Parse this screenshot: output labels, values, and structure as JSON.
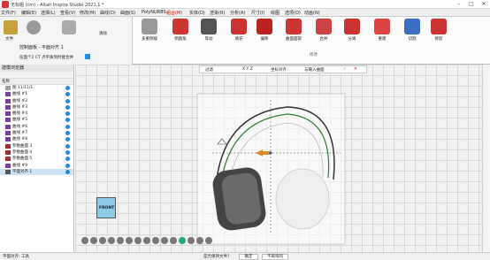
{
  "titlebar": {
    "title": "无标题 (cm) - Altair Inspire Studio 2021.1 *"
  },
  "menubar": {
    "items": [
      "文件(F)",
      "编辑(E)",
      "选择(L)",
      "查看(V)",
      "修改(M)",
      "曲线(D)",
      "曲面(S)",
      "PolyNURBS",
      "组合(M)",
      "实体(D)",
      "渲染(R)",
      "分析(A)",
      "尺寸(I)",
      "绘图",
      "选项(O)",
      "动画(N)"
    ],
    "active_index": 8
  },
  "ribbon": {
    "left": {
      "file_label": "文件",
      "panel_label": "控制面板 - 平面对齐 1",
      "option_label": "任面个2 CT 点平质到时能合并",
      "mode_label": "清除"
    },
    "buttons": [
      "多重倒棱",
      "倒圆角",
      "等动",
      "填充",
      "偏移",
      "曲面面取",
      "合并",
      "分离",
      "重建",
      "切割",
      "修剪"
    ],
    "group_label": "修改"
  },
  "left_panel": {
    "title": "建模浏览器",
    "header": "名称",
    "items": [
      {
        "label": "图 11/11/1",
        "icon": "folder-icon"
      },
      {
        "label": "曲线 #1",
        "icon": "curve-icon"
      },
      {
        "label": "曲线 #2",
        "icon": "curve-icon"
      },
      {
        "label": "曲线 #3",
        "icon": "curve-icon"
      },
      {
        "label": "曲线 #4",
        "icon": "curve-icon"
      },
      {
        "label": "曲线 #5",
        "icon": "curve-icon"
      },
      {
        "label": "曲线 #6",
        "icon": "curve-icon"
      },
      {
        "label": "曲线 #7",
        "icon": "curve-icon"
      },
      {
        "label": "曲线 #8",
        "icon": "curve-icon"
      },
      {
        "label": "参数曲面 3",
        "icon": "surface-icon"
      },
      {
        "label": "参数曲面 4",
        "icon": "surface-icon"
      },
      {
        "label": "参数曲面 5",
        "icon": "surface-icon"
      },
      {
        "label": "曲线 #9",
        "icon": "curve-icon"
      },
      {
        "label": "平面对齐 1",
        "icon": "plane-icon",
        "selected": true
      }
    ]
  },
  "viewport_toolbar": {
    "item1": "过滤",
    "item2": "X Y Z",
    "item3": "坐标对齐",
    "item4": "与输入曲面",
    "ok": "✓",
    "cancel": "✕"
  },
  "view_cube": {
    "label": "FRONT"
  },
  "statusbar": {
    "left": "平面对齐: 工具",
    "hint": "是否保持文件?",
    "confirm": "确定",
    "discard": "不再询问"
  },
  "colors": {
    "accent": "#c00000",
    "selection": "#cfe3f7",
    "check": "#1e88e5"
  }
}
